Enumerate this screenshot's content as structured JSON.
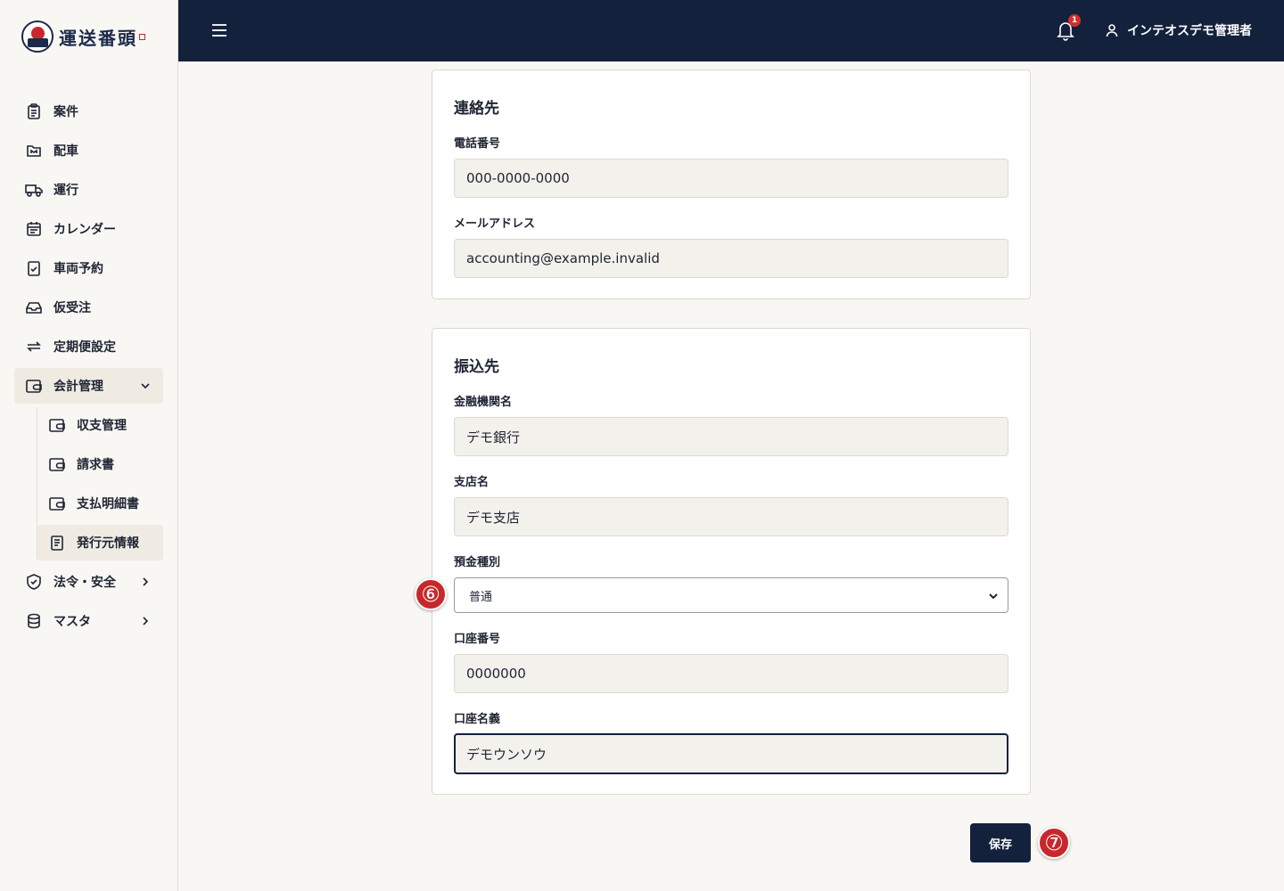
{
  "app": {
    "logo_text": "運送番頭"
  },
  "header": {
    "notification_count": "1",
    "user_name": "インテオスデモ管理者"
  },
  "sidebar": {
    "items": [
      {
        "label": "案件",
        "icon": "clipboard-icon"
      },
      {
        "label": "配車",
        "icon": "folder-icon"
      },
      {
        "label": "運行",
        "icon": "truck-icon"
      },
      {
        "label": "カレンダー",
        "icon": "calendar-icon"
      },
      {
        "label": "車両予約",
        "icon": "clipboard-check-icon"
      },
      {
        "label": "仮受注",
        "icon": "inbox-icon"
      },
      {
        "label": "定期便設定",
        "icon": "repeat-icon"
      },
      {
        "label": "会計管理",
        "icon": "wallet-icon",
        "expanded": true
      },
      {
        "label": "法令・安全",
        "icon": "shield-check-icon"
      },
      {
        "label": "マスタ",
        "icon": "database-icon"
      }
    ],
    "accounting_sub": [
      {
        "label": "収支管理",
        "icon": "wallet-icon"
      },
      {
        "label": "請求書",
        "icon": "wallet-icon"
      },
      {
        "label": "支払明細書",
        "icon": "wallet-icon"
      },
      {
        "label": "発行元情報",
        "icon": "document-icon",
        "active": true
      }
    ]
  },
  "contact": {
    "title": "連絡先",
    "phone_label": "電話番号",
    "phone_value": "000-0000-0000",
    "email_label": "メールアドレス",
    "email_value": "accounting@example.invalid"
  },
  "bank": {
    "title": "振込先",
    "bank_name_label": "金融機関名",
    "bank_name_value": "デモ銀行",
    "branch_label": "支店名",
    "branch_value": "デモ支店",
    "account_type_label": "預金種別",
    "account_type_value": "普通",
    "account_number_label": "口座番号",
    "account_number_value": "0000000",
    "account_holder_label": "口座名義",
    "account_holder_value": "デモウンソウ"
  },
  "actions": {
    "save_label": "保存"
  },
  "annotations": {
    "step6": "⑥",
    "step7": "⑦"
  },
  "colors": {
    "navy": "#13213d",
    "accent_red": "#c8282b",
    "background": "#f8f7f3"
  }
}
